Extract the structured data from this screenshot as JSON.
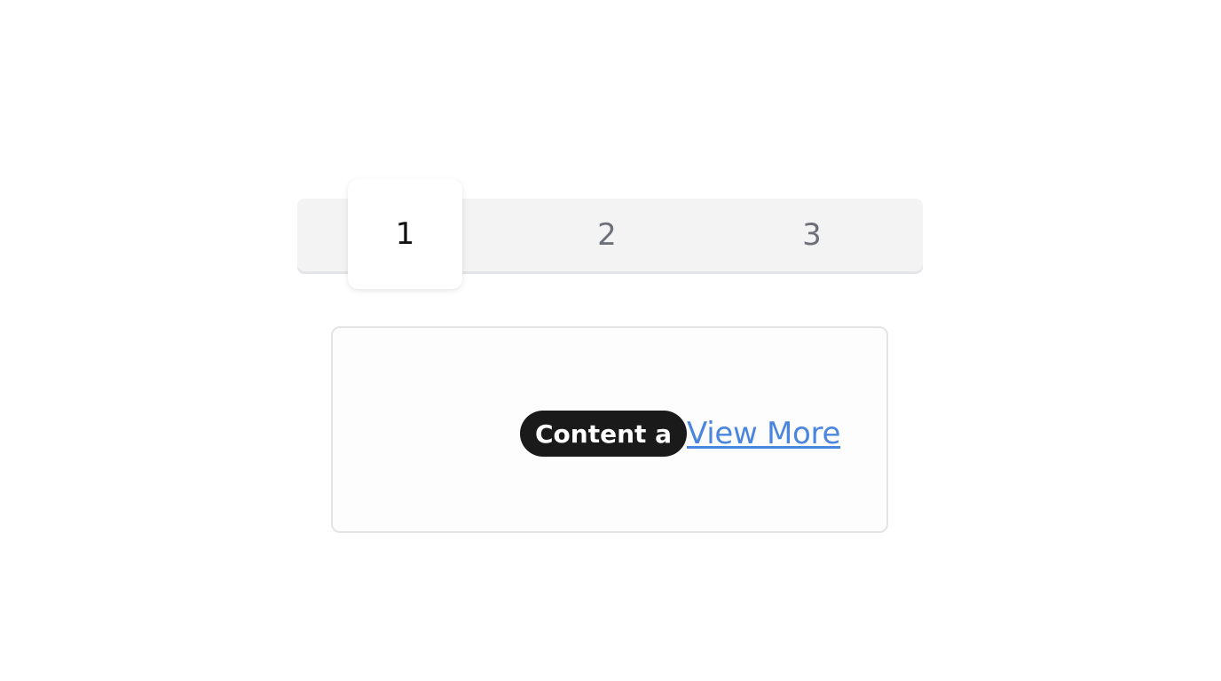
{
  "tabs": [
    {
      "label": "1",
      "active": true
    },
    {
      "label": "2",
      "active": false
    },
    {
      "label": "3",
      "active": false
    }
  ],
  "panel": {
    "badge_text": "Content a",
    "link_text": "View More"
  },
  "colors": {
    "tab_bar_bg": "#f3f3f4",
    "active_tab_bg": "#ffffff",
    "inactive_tab_text": "#6d7079",
    "active_tab_text": "#121212",
    "badge_bg": "#1a1a1b",
    "link": "#4a86df"
  }
}
